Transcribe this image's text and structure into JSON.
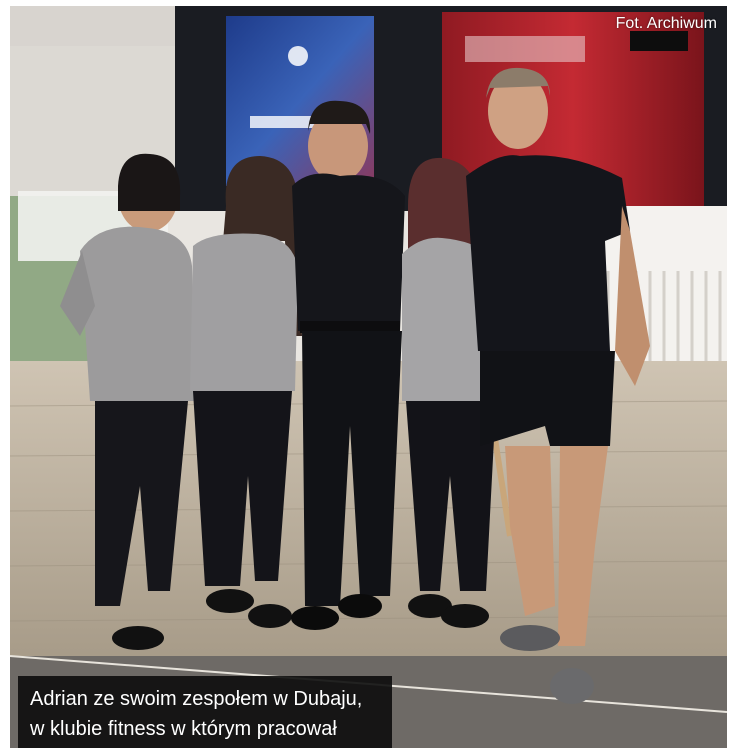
{
  "photo": {
    "credit": "Fot. Archiwum",
    "caption_line1": "Adrian ze swoim zespołem w Dubaju,",
    "caption_line2": "w klubie fitness w którym pracował"
  },
  "colors": {
    "wall_dark": "#1a1c22",
    "screen_blue": "#2d4fa0",
    "sign_red": "#b3202a",
    "floor_wood": "#b8ad9c",
    "caption_bg": "#0c0c0c"
  }
}
